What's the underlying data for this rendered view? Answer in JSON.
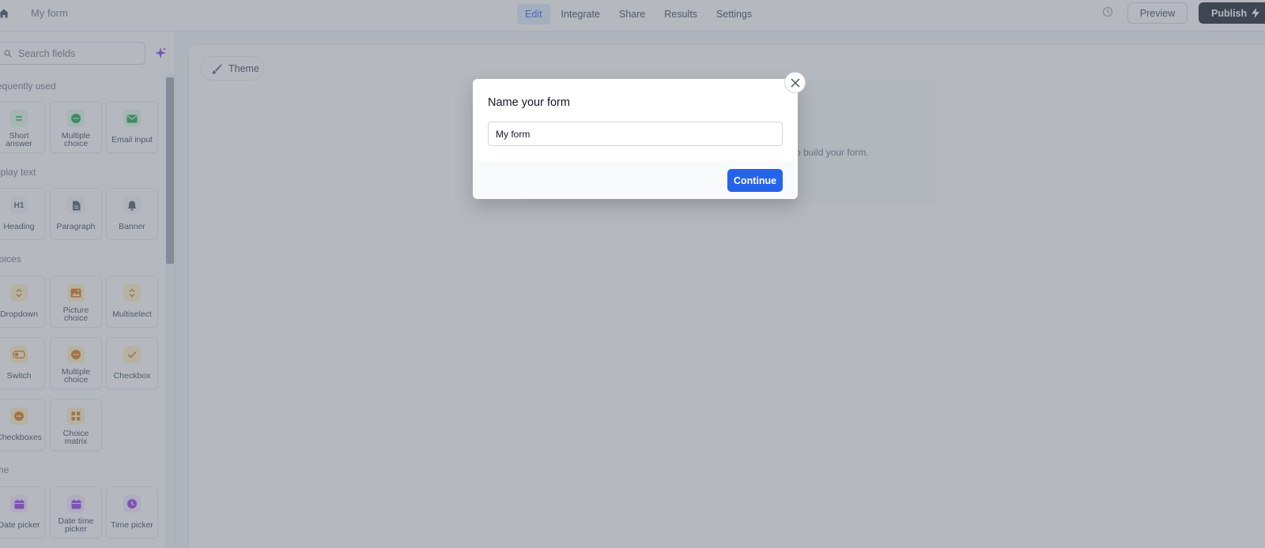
{
  "topbar": {
    "form_title": "My form",
    "tabs": [
      {
        "label": "Edit",
        "active": true
      },
      {
        "label": "Integrate",
        "active": false
      },
      {
        "label": "Share",
        "active": false
      },
      {
        "label": "Results",
        "active": false
      },
      {
        "label": "Settings",
        "active": false
      }
    ],
    "preview_label": "Preview",
    "publish_label": "Publish"
  },
  "sidebar": {
    "search_placeholder": "Search fields",
    "sections": [
      {
        "title": "requently used",
        "fields": [
          "Short answer",
          "Multiple choice",
          "Email input"
        ]
      },
      {
        "title": "isplay text",
        "fields": [
          "Heading",
          "Paragraph",
          "Banner"
        ]
      },
      {
        "title": "hoices",
        "fields": [
          "Dropdown",
          "Picture choice",
          "Multiselect",
          "Switch",
          "Multiple choice",
          "Checkbox",
          "Checkboxes",
          "Choice matrix"
        ]
      },
      {
        "title": "ime",
        "fields": [
          "Date picker",
          "Date time picker",
          "Time picker"
        ]
      }
    ],
    "field_labels": {
      "short_answer": "Short answer",
      "multiple_choice": "Multiple choice",
      "email_input": "Email input",
      "heading": "Heading",
      "paragraph": "Paragraph",
      "banner": "Banner",
      "dropdown": "Dropdown",
      "picture_choice": "Picture choice",
      "multiselect": "Multiselect",
      "switch": "Switch",
      "multiple_choice_2": "Multiple choice",
      "checkbox": "Checkbox",
      "checkboxes": "Checkboxes",
      "choice_matrix": "Choice matrix",
      "date_picker": "Date picker",
      "date_time_picker": "Date time picker",
      "time_picker": "Time picker"
    }
  },
  "canvas": {
    "theme_label": "Theme",
    "empty_hint": "o build your form."
  },
  "modal": {
    "title": "Name your form",
    "input_value": "My form",
    "continue_label": "Continue"
  },
  "colors": {
    "accent": "#2563eb",
    "publish_bg": "#111827",
    "overlay": "rgba(107,114,128,0.5)",
    "green_icon": "#16a34a",
    "amber_icon": "#d97706",
    "purple_icon": "#9333ea"
  }
}
